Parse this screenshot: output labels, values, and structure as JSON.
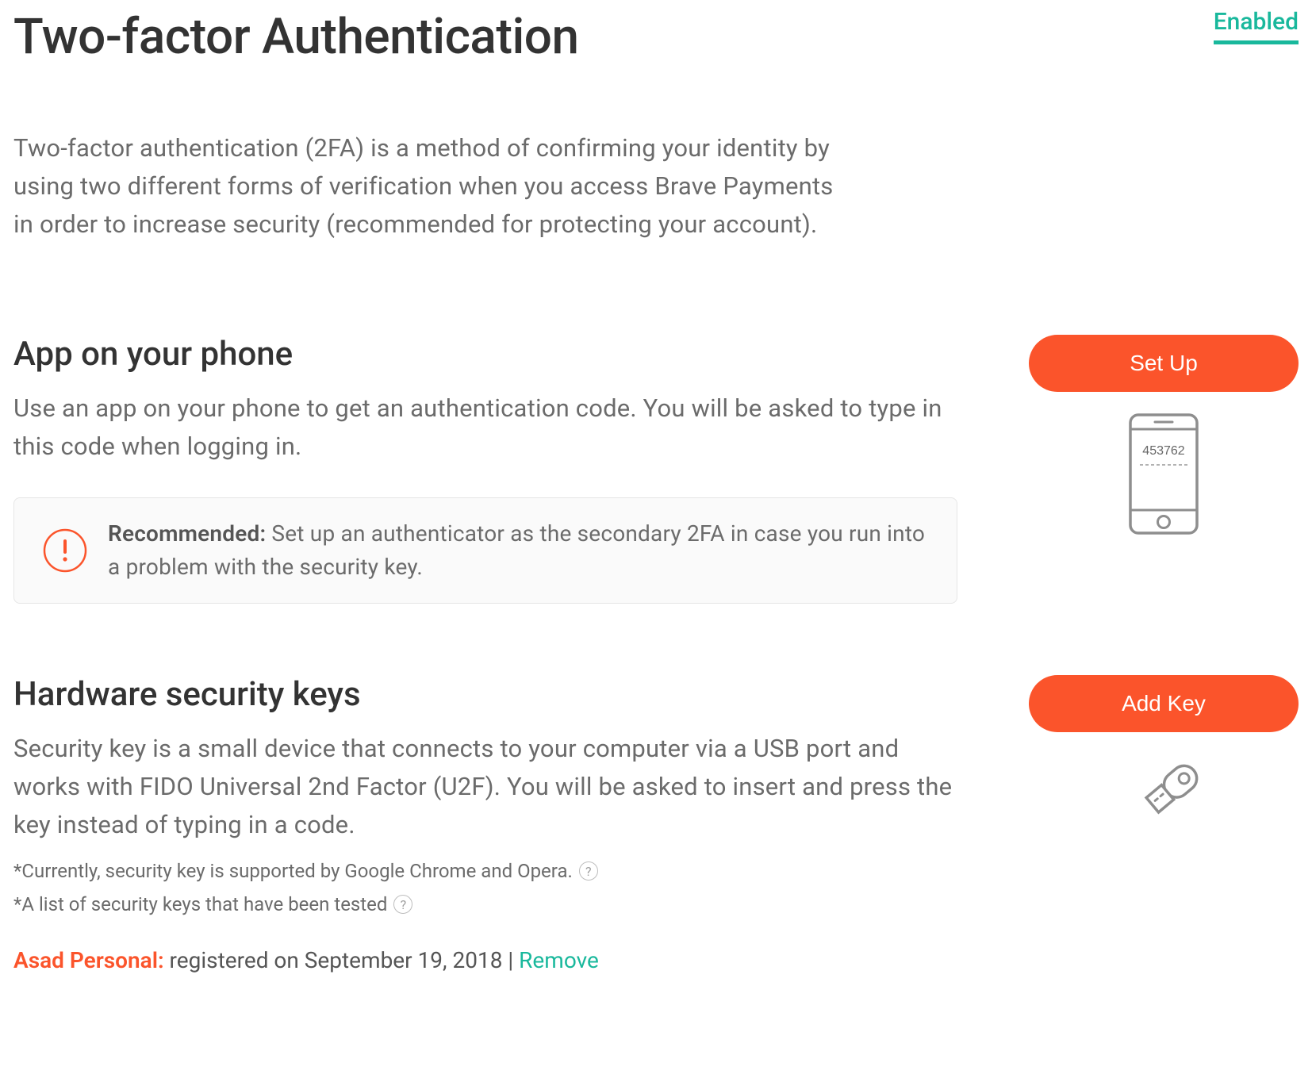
{
  "header": {
    "title": "Two-factor Authentication",
    "status": "Enabled"
  },
  "description": "Two-factor authentication (2FA) is a method of confirming your identity by using two different forms of verification when you access Brave Payments in order to increase security (recommended for protecting your account).",
  "appSection": {
    "title": "App on your phone",
    "description": "Use an app on your phone to get an authentication code. You will be asked to type in this code when logging in.",
    "button": "Set Up",
    "phoneCode": "453762",
    "info": {
      "labelStrong": "Recommended:",
      "text": " Set up an authenticator as the secondary 2FA in case you run into a problem with the security key."
    }
  },
  "hardwareSection": {
    "title": "Hardware security keys",
    "description": "Security key is a small device that connects to your computer via a USB port and works with FIDO Universal 2nd Factor (U2F). You will be asked to insert and press the key instead of typing in a code.",
    "button": "Add Key",
    "footnote1": "*Currently, security key is supported by Google Chrome and Opera.",
    "footnote2": "*A list of security keys that have been tested",
    "registered": {
      "keyName": "Asad Personal:",
      "info": " registered on September 19, 2018 | ",
      "removeLabel": "Remove"
    }
  }
}
